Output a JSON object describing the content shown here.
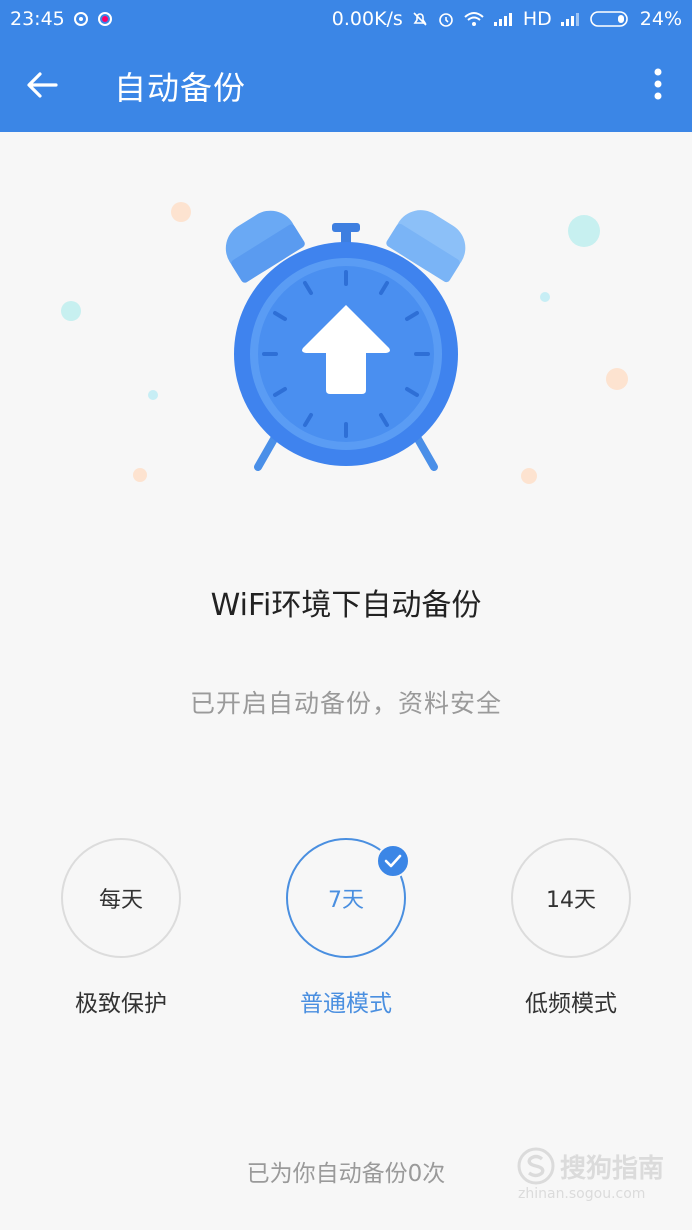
{
  "status_bar": {
    "time": "23:45",
    "network_speed": "0.00K/s",
    "hd_label": "HD",
    "battery": "24%"
  },
  "app_bar": {
    "title": "自动备份",
    "back_icon": "arrow-left-icon",
    "more_icon": "more-vertical-icon"
  },
  "hero": {
    "illustration": "alarm-clock-upload-icon",
    "headline": "WiFi环境下自动备份",
    "subline": "已开启自动备份，资料安全"
  },
  "options": [
    {
      "value": "每天",
      "label": "极致保护",
      "selected": false
    },
    {
      "value": "7天",
      "label": "普通模式",
      "selected": true
    },
    {
      "value": "14天",
      "label": "低频模式",
      "selected": false
    }
  ],
  "footer": {
    "count_text": "已为你自动备份0次"
  },
  "watermark": {
    "text": "搜狗指南",
    "sub": "zhinan.sogou.com"
  },
  "colors": {
    "primary": "#3b86e6",
    "selected": "#4a8fe0",
    "background": "#f7f7f7"
  }
}
